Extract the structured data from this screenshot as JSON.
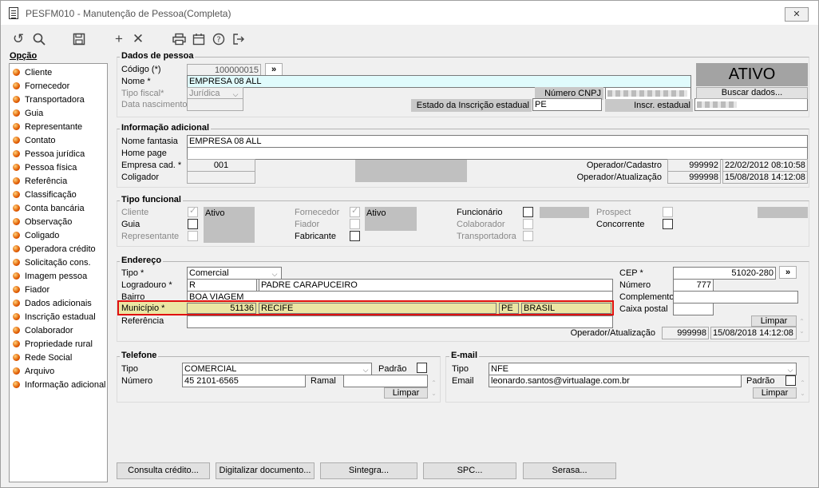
{
  "window": {
    "title": "PESFM010 - Manutenção de Pessoa(Completa)",
    "close_label": "✕"
  },
  "toolbar": {
    "icons": [
      "undo-icon",
      "search-icon",
      "save-icon",
      "add-icon",
      "delete-icon",
      "print-icon",
      "calendar-icon",
      "help-icon",
      "exit-icon"
    ]
  },
  "options": {
    "label": "Opção",
    "items": [
      "Cliente",
      "Fornecedor",
      "Transportadora",
      "Guia",
      "Representante",
      "Contato",
      "Pessoa jurídica",
      "Pessoa física",
      "Referência",
      "Classificação",
      "Conta bancária",
      "Observação",
      "Coligado",
      "Operadora crédito",
      "Solicitação cons.",
      "Imagem pessoa",
      "Fiador",
      "Dados adicionais",
      "Inscrição estadual",
      "Colaborador",
      "Propriedade rural",
      "Rede Social",
      "Arquivo",
      "Informação adicional"
    ]
  },
  "dados": {
    "title": "Dados de pessoa",
    "codigo_label": "Código (*)",
    "codigo": "100000015",
    "go": "»",
    "nome_label": "Nome *",
    "nome": "EMPRESA 08 ALL",
    "tipo_fiscal_label": "Tipo fiscal*",
    "tipo_fiscal": "Jurídica",
    "data_nasc_label": "Data nascimento",
    "cnpj_label": "Número CNPJ",
    "estado_label": "Estado da Inscrição estadual",
    "estado": "PE",
    "inscr_label": "Inscr. estadual",
    "buscar": "Buscar dados...",
    "status": "ATIVO"
  },
  "info": {
    "title": "Informação adicional",
    "fantasia_label": "Nome fantasia",
    "fantasia": "EMPRESA 08 ALL",
    "homepage_label": "Home page",
    "empresa_label": "Empresa cad. *",
    "empresa": "001",
    "coligador_label": "Coligador",
    "op_cad_label": "Operador/Cadastro",
    "op_cad": "999992",
    "op_cad_dt": "22/02/2012 08:10:58",
    "op_at_label": "Operador/Atualização",
    "op_at": "999998",
    "op_at_dt": "15/08/2018 14:12:08"
  },
  "funcional": {
    "title": "Tipo funcional",
    "cliente": "Cliente",
    "ativo1": "Ativo",
    "guia": "Guia",
    "representante": "Representante",
    "fornecedor": "Fornecedor",
    "ativo2": "Ativo",
    "fiador": "Fiador",
    "fabricante": "Fabricante",
    "funcionario": "Funcionário",
    "colaborador": "Colaborador",
    "transportadora": "Transportadora",
    "prospect": "Prospect",
    "concorrente": "Concorrente"
  },
  "endereco": {
    "title": "Endereço",
    "tipo_label": "Tipo *",
    "tipo": "Comercial",
    "logradouro_label": "Logradouro *",
    "log_tipo": "R",
    "logradouro": "PADRE CARAPUCEIRO",
    "bairro_label": "Bairro",
    "bairro": "BOA VIAGEM",
    "municipio_label": "Município *",
    "mun_cod": "51136",
    "municipio": "RECIFE",
    "uf": "PE",
    "pais": "BRASIL",
    "referencia_label": "Referência",
    "cep_label": "CEP *",
    "cep": "51020-280",
    "numero_label": "Número",
    "numero": "777",
    "complemento_label": "Complemento",
    "caixa_label": "Caixa postal",
    "limpar": "Limpar",
    "op_label": "Operador/Atualização",
    "op": "999998",
    "op_dt": "15/08/2018 14:12:08"
  },
  "telefone": {
    "title": "Telefone",
    "tipo_label": "Tipo",
    "tipo": "COMERCIAL",
    "padrao_label": "Padrão",
    "numero_label": "Número",
    "numero": "45 2101-6565",
    "ramal_label": "Ramal",
    "limpar": "Limpar"
  },
  "email": {
    "title": "E-mail",
    "tipo_label": "Tipo",
    "tipo": "NFE",
    "email_label": "Email",
    "email": "leonardo.santos@virtualage.com.br",
    "padrao_label": "Padrão",
    "limpar": "Limpar"
  },
  "bottom": {
    "buttons": [
      "Consulta crédito...",
      "Digitalizar documento...",
      "Sintegra...",
      "SPC...",
      "Serasa..."
    ]
  }
}
